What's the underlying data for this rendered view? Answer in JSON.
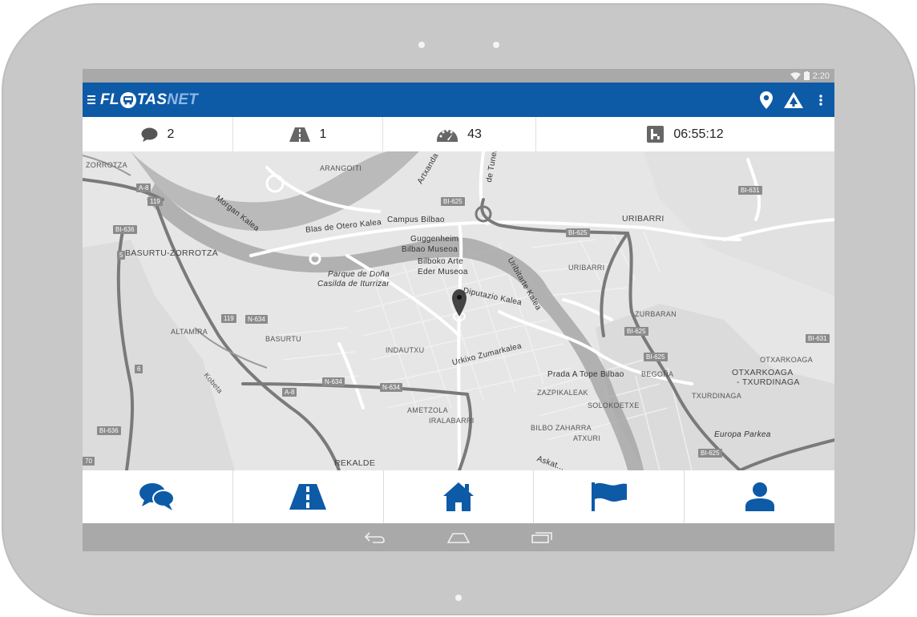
{
  "statusbar": {
    "time": "2:20"
  },
  "app": {
    "logo_fl": "FL",
    "logo_tas": "TAS",
    "logo_net": "NET"
  },
  "stats": {
    "messages": "2",
    "routes": "1",
    "speed": "43",
    "driving_time": "06:55:12"
  },
  "map": {
    "labels": {
      "zorrotza": "ZORROTZA",
      "arangoiti": "ARANGOITI",
      "artxanda": "Artxanda",
      "tunela": "de Tunela",
      "morgan": "Morgan Kalea",
      "campus": "Campus Bilbao",
      "blas": "Blas de Otero Kalea",
      "uribarri": "URIBARRI",
      "uribarri_small": "URIBARRI",
      "basurtu_zorrotza": "BASURTU-ZORROTZA",
      "guggenheim1": "Guggenheim",
      "guggenheim2": "Bilbao Museoa",
      "bilboko1": "Bilboko Arte",
      "bilboko2": "Eder Museoa",
      "parque1": "Parque de Doña",
      "parque2": "Casilda de Iturrizar",
      "diputazio": "Diputazio Kalea",
      "uribitarte": "Uribitarte Kalea",
      "zurbaran": "ZURBARAN",
      "altamira": "ALTAMIRA",
      "basurtu": "BASURTU",
      "indautxu": "INDAUTXU",
      "urkixo": "Urkixo Zumarkalea",
      "otxarkoaga": "OTXARKOAGA",
      "otxarkoaga_tx1": "OTXARKOAGA",
      "otxarkoaga_tx2": "- TXURDINAGA",
      "begona": "BEGOÑA",
      "prada": "Prada A Tope Bilbao",
      "kobeta": "Kobeta",
      "zazpikaleak": "ZAZPIKALEAK",
      "txurdinaga": "TXURDINAGA",
      "solokoetxe": "SOLOKOETXE",
      "ametzola": "AMETZOLA",
      "iralabarri": "IRALABARRI",
      "bilbo_zaharra": "BILBO ZAHARRA",
      "atxuri": "ATXURI",
      "europa": "Europa Parkea",
      "rekalde": "REKALDE",
      "askatasuna": "Askat..."
    },
    "shields": {
      "a8_top": "A-8",
      "n119_top": "119",
      "bi636_top": "BI-636",
      "n5": "5",
      "bi625_a": "BI-625",
      "bi625_b": "BI-625",
      "bi625_c": "BI-625",
      "bi625_d": "BI-625",
      "bi625_e": "BI-625",
      "bi631_a": "BI-631",
      "bi631_b": "BI-631",
      "n119_mid": "119",
      "n634_a": "N-634",
      "n634_b": "N-634",
      "n634_c": "N-634",
      "a8_bot": "A-8",
      "n6": "6",
      "bi636_bot": "BI-636",
      "n70": "70"
    }
  },
  "nav": {
    "messages": "messages-icon",
    "routes": "road-icon",
    "home": "home-icon",
    "flag": "flag-icon",
    "profile": "user-icon"
  },
  "colors": {
    "primary": "#0d5aa7",
    "light_blue": "#8fb7e3",
    "map_bg": "#e6e6e6"
  }
}
